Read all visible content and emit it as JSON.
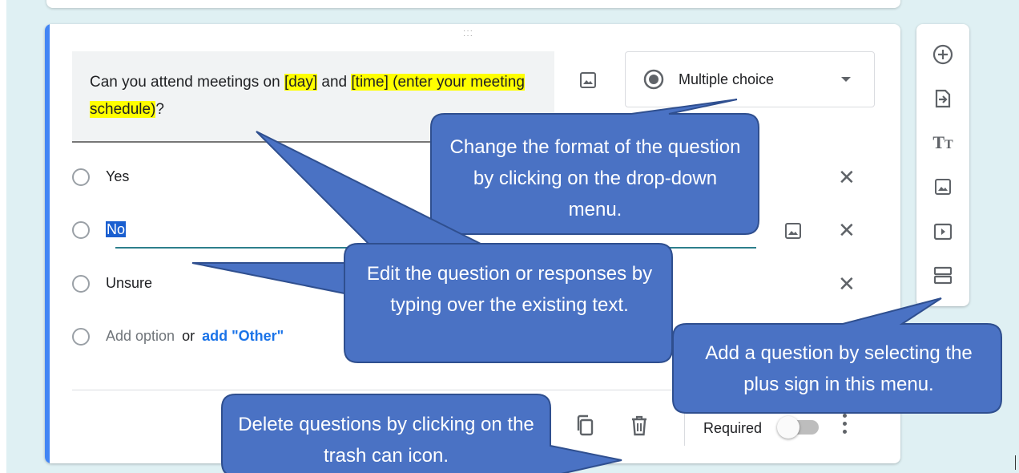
{
  "question": {
    "parts": [
      {
        "text": "Can you attend meetings on ",
        "hl": false
      },
      {
        "text": "[day]",
        "hl": true
      },
      {
        "text": " and ",
        "hl": false
      },
      {
        "text": "[time] (enter your meeting schedule)",
        "hl": true
      },
      {
        "text": "?",
        "hl": false
      }
    ]
  },
  "question_type": {
    "label": "Multiple choice"
  },
  "options": [
    {
      "label": "Yes"
    },
    {
      "label": "No"
    },
    {
      "label": "Unsure"
    }
  ],
  "add_option": {
    "label": "Add option",
    "or": "or",
    "other": "add \"Other\""
  },
  "footer": {
    "required_label": "Required"
  },
  "callouts": {
    "format": "Change the format of the question by clicking on the drop-down menu.",
    "edit": "Edit the question or responses by typing over the existing text.",
    "add": "Add a question by selecting the plus sign in this menu.",
    "delete": "Delete questions by clicking on the trash can icon."
  },
  "colors": {
    "accent": "#4285f4",
    "highlight": "#ffff00",
    "callout_fill": "#4a72c4",
    "callout_border": "#2f4f8f",
    "background": "#dff0f3"
  },
  "icons": {
    "side_menu": [
      "add-question-icon",
      "import-questions-icon",
      "add-title-icon",
      "add-image-icon",
      "add-video-icon",
      "add-section-icon"
    ],
    "footer": [
      "duplicate-icon",
      "trash-icon",
      "more-options-icon"
    ]
  }
}
